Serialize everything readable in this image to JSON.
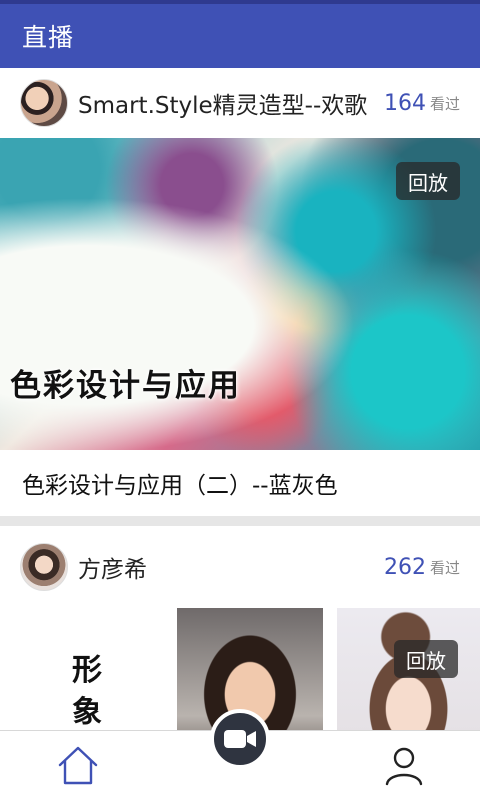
{
  "appbar": {
    "title": "直播"
  },
  "feed": [
    {
      "author": "Smart.Style精灵造型--欢歌",
      "views": "164",
      "views_label": "看过",
      "cover_text": "色彩设计与应用",
      "badge": "回放",
      "title": "色彩设计与应用（二）--蓝灰色"
    },
    {
      "author": "方彦希",
      "views": "262",
      "views_label": "看过",
      "cover_text": "形象设",
      "badge": "回放"
    }
  ],
  "bottom_nav": {
    "home_icon": "home-icon",
    "camera_icon": "video-camera-icon",
    "profile_icon": "user-icon"
  },
  "colors": {
    "primary": "#3f51b5",
    "accent_text": "#3f51b5"
  }
}
